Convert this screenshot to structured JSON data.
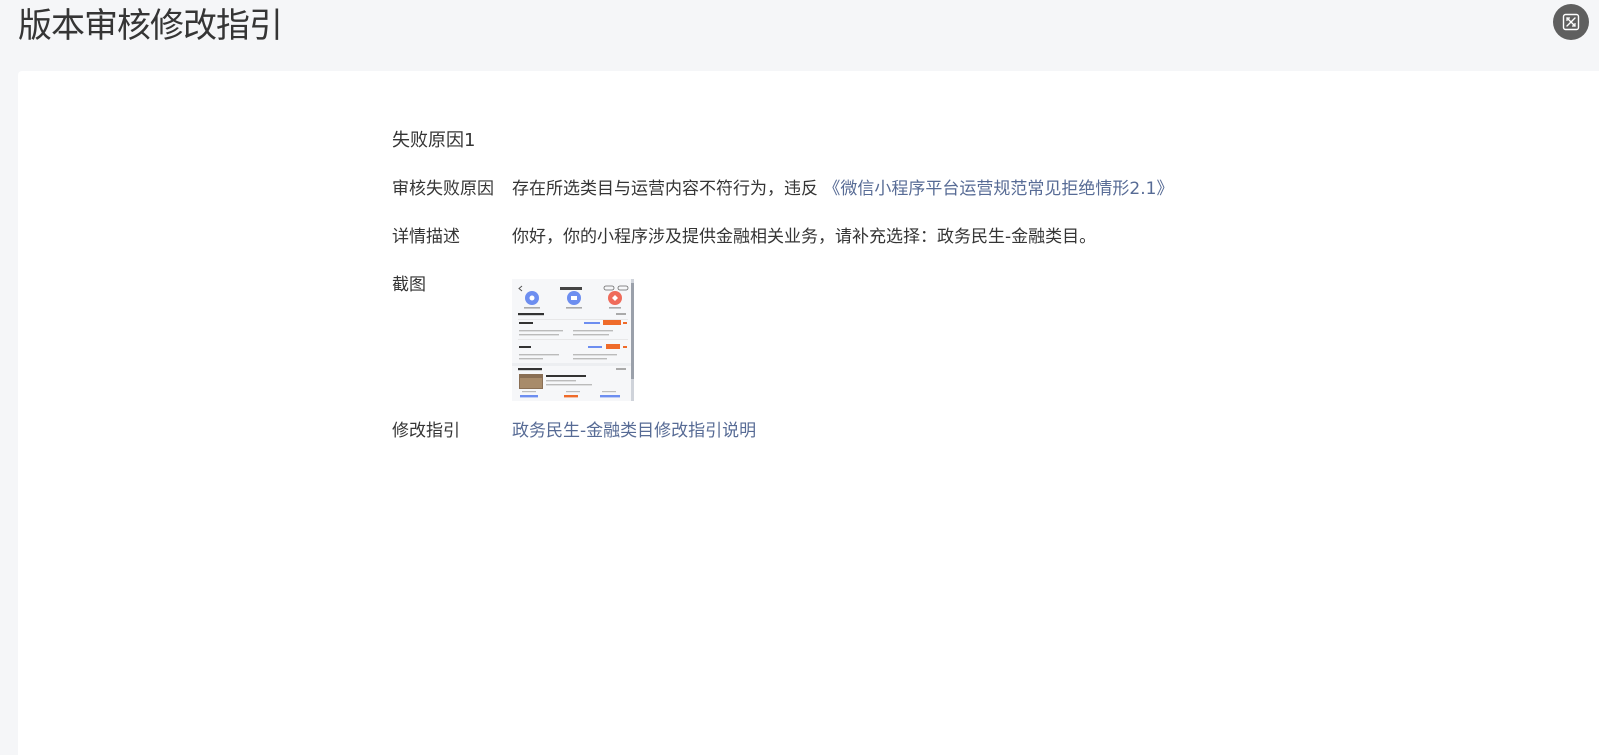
{
  "header": {
    "title": "版本审核修改指引",
    "close_icon": "fullscreen-exit-icon"
  },
  "detail": {
    "section_title": "失败原因1",
    "reason_label": "审核失败原因",
    "reason_text": "存在所选类目与运营内容不符行为，违反",
    "reason_link": "《微信小程序平台运营规范常见拒绝情形2.1》",
    "desc_label": "详情描述",
    "desc_text": "你好，你的小程序涉及提供金融相关业务，请补充选择：政务民生-金融类目。",
    "screenshot_label": "截图",
    "guide_label": "修改指引",
    "guide_link": "政务民生-金融类目修改指引说明"
  },
  "colors": {
    "link": "#576b95",
    "text": "#353535",
    "page_bg": "#f5f6f8",
    "card_bg": "#ffffff",
    "close_bg": "#5f5f5f"
  }
}
